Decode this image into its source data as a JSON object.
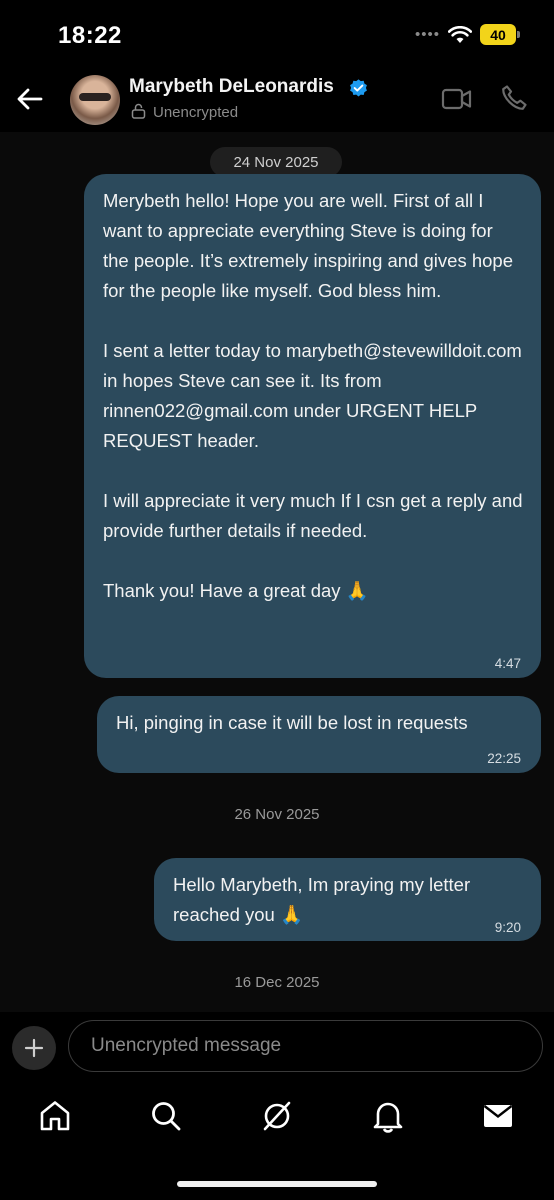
{
  "status_bar": {
    "time": "18:22",
    "signal_dots": "••••",
    "battery": "40"
  },
  "header": {
    "name": "Marybeth DeLeonardis",
    "subtitle": "Unencrypted",
    "icons": [
      "back-arrow-icon",
      "verified-badge-icon",
      "lock-icon",
      "video-call-icon",
      "phone-icon"
    ]
  },
  "messages": [
    {
      "date": "24 Nov 2025",
      "text": "Merybeth hello! Hope you are well. First of all I want to appreciate everything Steve is doing for the people. It’s extremely inspiring and gives hope for the people like myself. God bless him.\n\nI sent a letter today to marybeth@stevewilldoit.com in hopes Steve can see it. Its from rinnen022@gmail.com under URGENT HELP REQUEST header.\n\nI will appreciate it very much If I csn get a reply and provide further details if needed.\n\nThank you! Have a great day 🙏",
      "time": "4:47"
    },
    {
      "text": "Hi, pinging in case it will be lost in requests",
      "time": "22:25"
    },
    {
      "date": "26 Nov 2025",
      "text": "Hello Marybeth, Im praying my letter reached you 🙏",
      "time": "9:20"
    }
  ],
  "last_date": "16 Dec 2025",
  "composer": {
    "placeholder": "Unencrypted message"
  },
  "tabs": [
    "home-icon",
    "search-icon",
    "grok-icon",
    "notifications-icon",
    "messages-icon"
  ],
  "colors": {
    "bubble": "#2c4a5c",
    "verified": "#1d9bf0",
    "battery": "#f2d41a",
    "background": "#000000"
  }
}
